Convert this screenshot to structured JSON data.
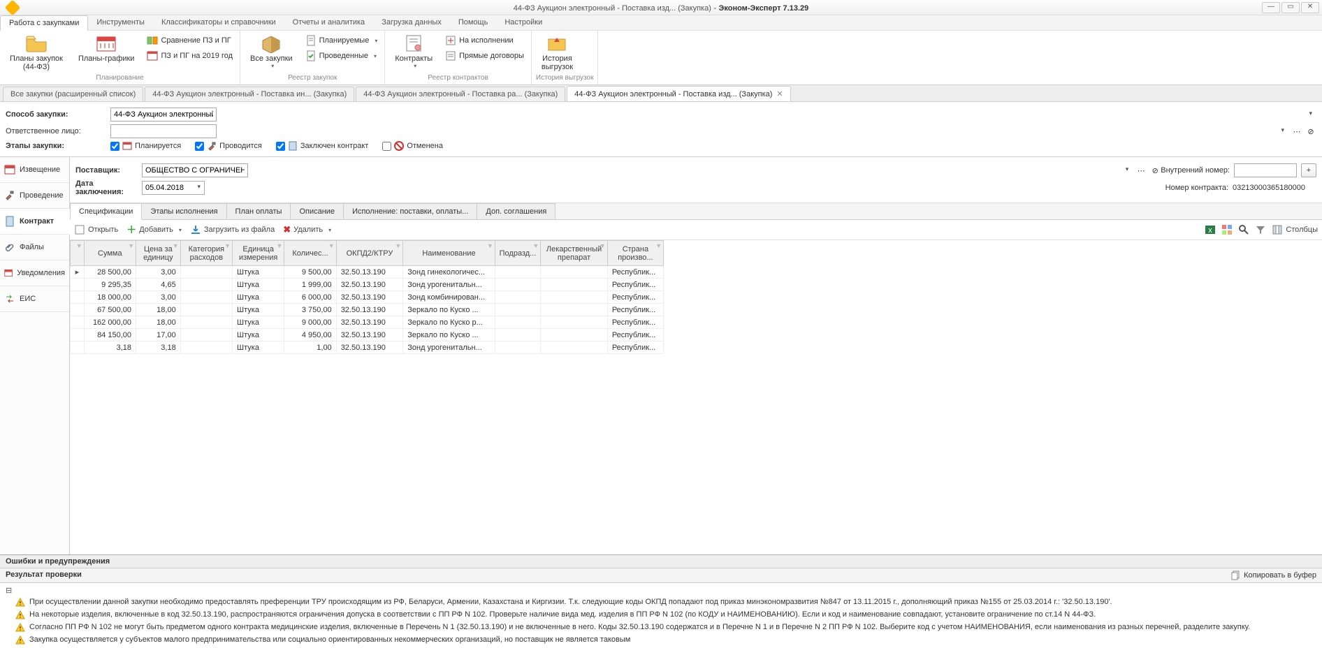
{
  "title": {
    "doc": "44-ФЗ Аукцион электронный - Поставка изд... (Закупка)",
    "app": "Эконом-Эксперт 7.13.29"
  },
  "menus": [
    "Работа с закупками",
    "Инструменты",
    "Классификаторы и справочники",
    "Отчеты и аналитика",
    "Загрузка данных",
    "Помощь",
    "Настройки"
  ],
  "ribbon": {
    "plans44": "Планы закупок\n(44-ФЗ)",
    "plangraf": "Планы-графики",
    "cmp": "Сравнение ПЗ и ПГ",
    "pzpg2019": "ПЗ и ПГ на 2019 год",
    "group_plan": "Планирование",
    "allpurch": "Все закупки",
    "planned": "Планируемые",
    "done": "Проведенные",
    "group_reg": "Реестр закупок",
    "contracts": "Контракты",
    "onexec": "На исполнении",
    "direct": "Прямые договоры",
    "group_contr": "Реестр контрактов",
    "history": "История\nвыгрузок",
    "group_hist": "История выгрузок"
  },
  "doctabs": [
    "Все закупки (расширенный список)",
    "44-ФЗ Аукцион электронный - Поставка  ин... (Закупка)",
    "44-ФЗ Аукцион электронный - Поставка  ра... (Закупка)",
    "44-ФЗ Аукцион электронный - Поставка изд... (Закупка)"
  ],
  "form": {
    "method_lbl": "Способ закупки:",
    "method_val": "44-ФЗ Аукцион электронный",
    "resp_lbl": "Ответственное лицо:",
    "stages_lbl": "Этапы закупки:",
    "st_plan": "Планируется",
    "st_run": "Проводится",
    "st_contract": "Заключен контракт",
    "st_cancel": "Отменена"
  },
  "side": {
    "notice": "Извещение",
    "run": "Проведение",
    "contract": "Контракт",
    "files": "Файлы",
    "notif": "Уведомления",
    "eis": "ЕИС"
  },
  "contract": {
    "supplier_lbl": "Поставщик:",
    "supplier_val": "ОБЩЕСТВО С ОГРАНИЧЕННОЙ ОТВЕТСТВЕННОСТЬЮ \"МЕДЛАБРУС\"",
    "date_lbl": "Дата заключения:",
    "date_val": "05.04.2018",
    "intnum_lbl": "Внутренний номер:",
    "cnum_lbl": "Номер контракта:",
    "cnum_val": "03213000365180000"
  },
  "subtabs": [
    "Спецификации",
    "Этапы исполнения",
    "План оплаты",
    "Описание",
    "Исполнение: поставки, оплаты...",
    "Доп. соглашения"
  ],
  "gridbar": {
    "open": "Открыть",
    "add": "Добавить",
    "load": "Загрузить из файла",
    "del": "Удалить",
    "cols": "Столбцы"
  },
  "cols": [
    "",
    "Сумма",
    "Цена за единицу",
    "Категория расходов",
    "Единица измерения",
    "Количес...",
    "ОКПД2/КТРУ",
    "Наименование",
    "Подразд...",
    "Лекарственный препарат",
    "Страна произво..."
  ],
  "rows": [
    {
      "mark": "▸",
      "sum": "28 500,00",
      "price": "3,00",
      "cat": "",
      "unit": "Штука",
      "qty": "9 500,00",
      "okpd": "32.50.13.190",
      "name": "Зонд гинекологичес...",
      "sub": "",
      "drug": "",
      "country": "Республик..."
    },
    {
      "mark": "",
      "sum": "9 295,35",
      "price": "4,65",
      "cat": "",
      "unit": "Штука",
      "qty": "1 999,00",
      "okpd": "32.50.13.190",
      "name": "Зонд урогенитальн...",
      "sub": "",
      "drug": "",
      "country": "Республик..."
    },
    {
      "mark": "",
      "sum": "18 000,00",
      "price": "3,00",
      "cat": "",
      "unit": "Штука",
      "qty": "6 000,00",
      "okpd": "32.50.13.190",
      "name": "Зонд комбинирован...",
      "sub": "",
      "drug": "",
      "country": "Республик..."
    },
    {
      "mark": "",
      "sum": "67 500,00",
      "price": "18,00",
      "cat": "",
      "unit": "Штука",
      "qty": "3 750,00",
      "okpd": "32.50.13.190",
      "name": "Зеркало  по Куско ...",
      "sub": "",
      "drug": "",
      "country": "Республик..."
    },
    {
      "mark": "",
      "sum": "162 000,00",
      "price": "18,00",
      "cat": "",
      "unit": "Штука",
      "qty": "9 000,00",
      "okpd": "32.50.13.190",
      "name": "Зеркало  по Куско р...",
      "sub": "",
      "drug": "",
      "country": "Республик..."
    },
    {
      "mark": "",
      "sum": "84 150,00",
      "price": "17,00",
      "cat": "",
      "unit": "Штука",
      "qty": "4 950,00",
      "okpd": "32.50.13.190",
      "name": "Зеркало  по Куско ...",
      "sub": "",
      "drug": "",
      "country": "Республик..."
    },
    {
      "mark": "",
      "sum": "3,18",
      "price": "3,18",
      "cat": "",
      "unit": "Штука",
      "qty": "1,00",
      "okpd": "32.50.13.190",
      "name": "Зонд урогенитальн...",
      "sub": "",
      "drug": "",
      "country": "Республик..."
    }
  ],
  "errors": {
    "title": "Ошибки и предупреждения",
    "sub": "Результат проверки",
    "copy": "Копировать в буфер",
    "items": [
      "При осуществлении данной закупки необходимо предоставлять преференции ТРУ происходящим из РФ, Беларуси, Армении, Казахстана и Киргизии. Т.к. следующие коды ОКПД попадают под приказ минэкономразвития №847 от 13.11.2015 г., дополняющий приказ №155 от 25.03.2014 г.: '32.50.13.190'.",
      "На некоторые изделия, включенные в код 32.50.13.190, распространяются ограничения допуска в соответствии с ПП РФ N 102. Проверьте наличие вида мед. изделия в ПП РФ N 102 (по КОДУ и НАИМЕНОВАНИЮ). Если и код и наименование совпадают, установите ограничение по ст.14 N 44-ФЗ.",
      "Согласно ПП РФ N 102 не могут быть предметом одного контракта медицинские изделия, включенные в Перечень N 1 (32.50.13.190) и не включенные в него. Коды 32.50.13.190 содержатся и в Перечне N 1 и в Перечне N 2 ПП РФ N 102. Выберите код с учетом НАИМЕНОВАНИЯ, если наименования из разных перечней, разделите закупку.",
      "Закупка осуществляется у субъектов малого предпринимательства или социально ориентированных некоммерческих организаций, но поставщик не является таковым"
    ]
  }
}
